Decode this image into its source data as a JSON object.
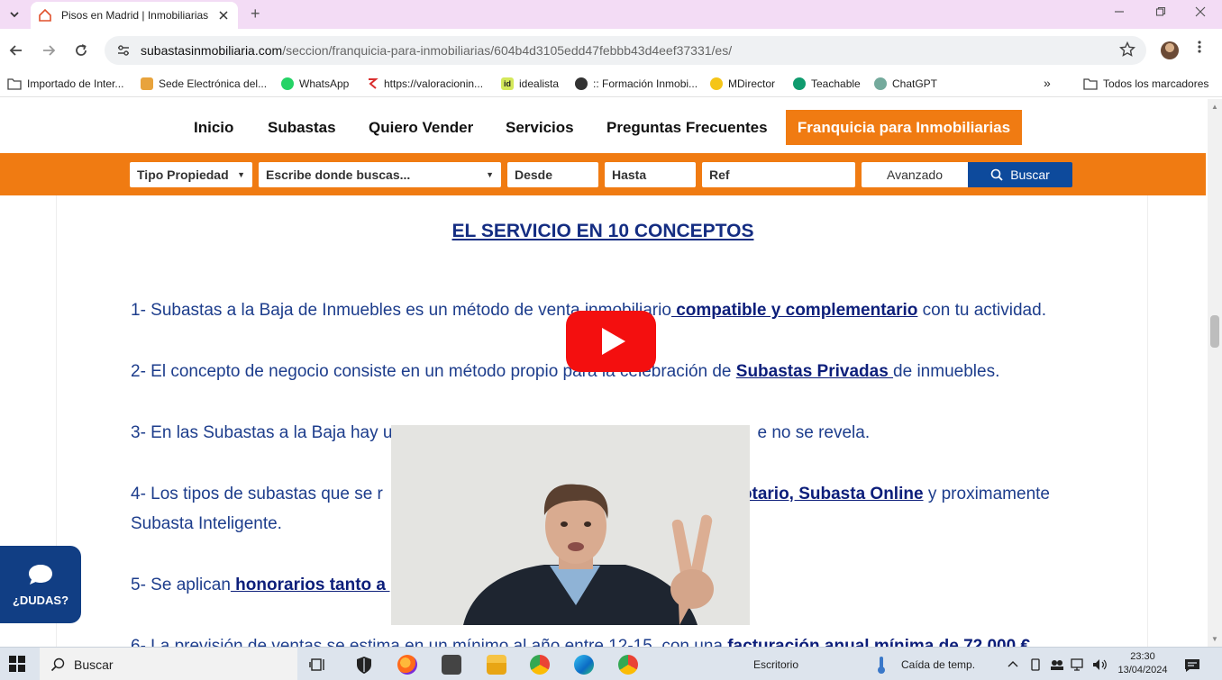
{
  "browser": {
    "tab_title": "Pisos en Madrid | Inmobiliarias",
    "new_tab_symbol": "+",
    "url_host": "subastasinmobiliaria.com",
    "url_path": "/seccion/franquicia-para-inmobiliarias/604b4d3105edd47febbb43d4eef37331/es/"
  },
  "bookmarks": [
    {
      "label": "Importado de Inter...",
      "color": "#ffffff"
    },
    {
      "label": "Sede Electrónica del...",
      "color": "#e8a33c"
    },
    {
      "label": "WhatsApp",
      "color": "#25d366"
    },
    {
      "label": "https://valoracionin...",
      "color": "#d92d2d"
    },
    {
      "label": "idealista",
      "color": "#d4e85a"
    },
    {
      "label": ":: Formación Inmobi...",
      "color": "#333333"
    },
    {
      "label": "MDirector",
      "color": "#f5c518"
    },
    {
      "label": "Teachable",
      "color": "#0f9b6e"
    },
    {
      "label": "ChatGPT",
      "color": "#74aa9c"
    }
  ],
  "bookmarks_overflow": "»",
  "bookmarks_all": "Todos los marcadores",
  "nav": {
    "items": [
      "Inicio",
      "Subastas",
      "Quiero Vender",
      "Servicios",
      "Preguntas Frecuentes"
    ],
    "active": "Franquicia para Inmobiliarias"
  },
  "search": {
    "tipo": "Tipo Propiedad",
    "donde": "Escribe donde buscas...",
    "desde": "Desde",
    "hasta": "Hasta",
    "ref": "Ref",
    "avanzado": "Avanzado",
    "buscar": "Buscar"
  },
  "content": {
    "heading": "EL SERVICIO EN 10 CONCEPTOS",
    "p1_a": "1- Subastas a la Baja de Inmuebles es un método de venta inmobiliario",
    "p1_link": " compatible y complementario",
    "p1_b": " con tu actividad.",
    "p2_a": "2- El concepto de negocio consiste en un método propio para la celebración de ",
    "p2_link": "Subastas Privadas ",
    "p2_b": "de inmuebles.",
    "p3_a": "3- En las Subastas a la Baja hay u",
    "p3_b": "e no se revela.",
    "p4_a": "4- Los tipos de subastas que se r",
    "p4_link": "otario, Subasta Online",
    "p4_b": " y proximamente",
    "p4_c": "Subasta Inteligente.",
    "p5_a": "5- Se aplican",
    "p5_link": " honorarios tanto a p",
    "p6_a": "6- La previsión de ventas se estima en un mínimo al año entre 12-15, con una ",
    "p6_link": "facturación anual mínima de 72.000 €"
  },
  "dudas": "¿DUDAS?",
  "taskbar": {
    "search": "Buscar",
    "escritorio": "Escritorio",
    "weather": "Caída de temp.",
    "time": "23:30",
    "date": "13/04/2024"
  },
  "colors": {
    "orange": "#f07b12",
    "navy": "#0d4a9c",
    "text_blue": "#1d3d8c"
  }
}
